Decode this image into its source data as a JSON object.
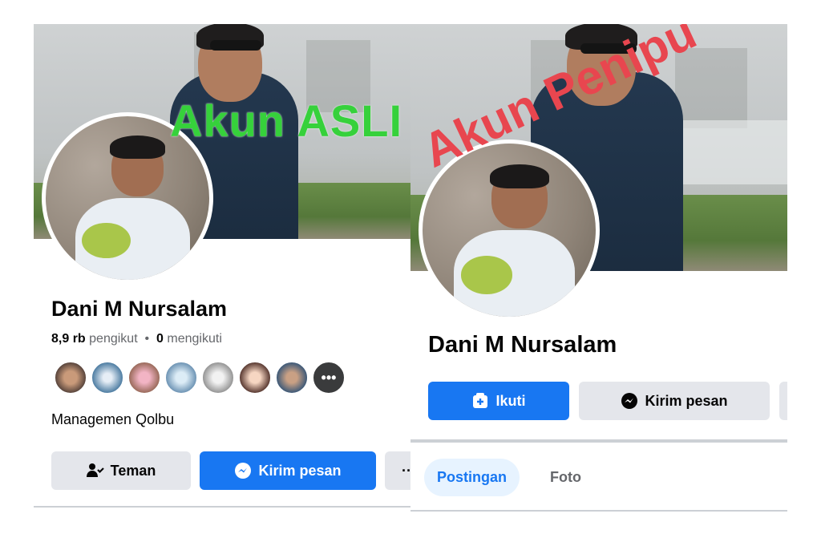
{
  "left": {
    "overlay_label": "Akun ASLI",
    "profile": {
      "name": "Dani M Nursalam",
      "followers_count": "8,9 rb",
      "followers_label": "pengikut",
      "separator": "•",
      "following_count": "0",
      "following_label": "mengikuti",
      "bio": "Managemen Qolbu",
      "more_friends_glyph": "•••"
    },
    "buttons": {
      "friends_label": "Teman",
      "message_label": "Kirim pesan",
      "more_label": "···"
    }
  },
  "right": {
    "overlay_label": "Akun Penipu",
    "profile": {
      "name": "Dani M Nursalam"
    },
    "buttons": {
      "follow_label": "Ikuti",
      "message_label": "Kirim pesan"
    },
    "tabs": [
      {
        "label": "Postingan",
        "active": true
      },
      {
        "label": "Foto",
        "active": false
      }
    ]
  },
  "colors": {
    "facebook_blue": "#1877f2",
    "secondary_button": "#e4e6eb",
    "overlay_green": "#36d13b",
    "overlay_red": "#e8464f"
  },
  "icons": [
    "friends-check-icon",
    "messenger-icon",
    "more-icon",
    "follow-icon"
  ]
}
